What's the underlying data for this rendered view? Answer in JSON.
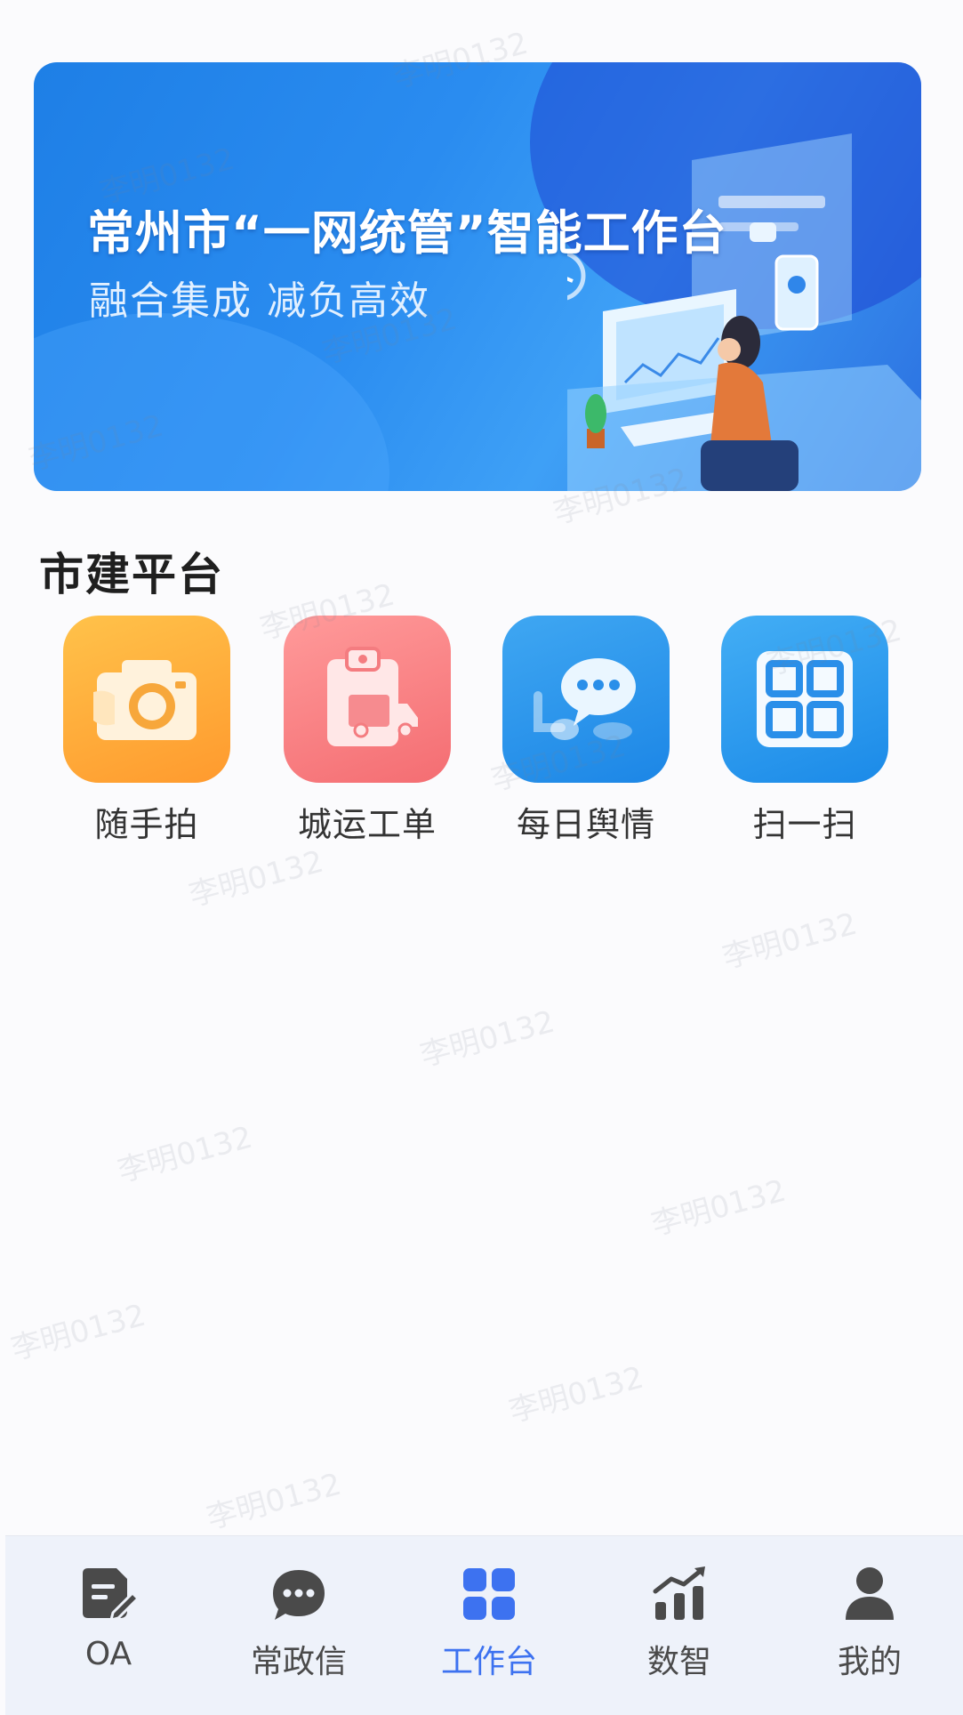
{
  "banner": {
    "title": "常州市“一网统管”智能工作台",
    "subtitle": "融合集成   减负高效"
  },
  "section": {
    "title": "市建平台",
    "apps": [
      {
        "label": "随手拍",
        "icon": "camera-icon",
        "color": "#ffae3d"
      },
      {
        "label": "城运工单",
        "icon": "clipboard-truck-icon",
        "color": "#f77f84"
      },
      {
        "label": "每日舆情",
        "icon": "chat-bubbles-icon",
        "color": "#2a95ec"
      },
      {
        "label": "扫一扫",
        "icon": "qr-scan-icon",
        "color": "#2a95ec"
      }
    ]
  },
  "nav": {
    "items": [
      {
        "label": "OA",
        "icon": "document-edit-icon"
      },
      {
        "label": "常政信",
        "icon": "chat-icon"
      },
      {
        "label": "工作台",
        "icon": "grid-icon",
        "active": true
      },
      {
        "label": "数智",
        "icon": "chart-trend-icon"
      },
      {
        "label": "我的",
        "icon": "person-icon"
      }
    ],
    "active_color": "#3d72f0",
    "inactive_color": "#4a4a4a"
  },
  "watermark": "李明0132"
}
